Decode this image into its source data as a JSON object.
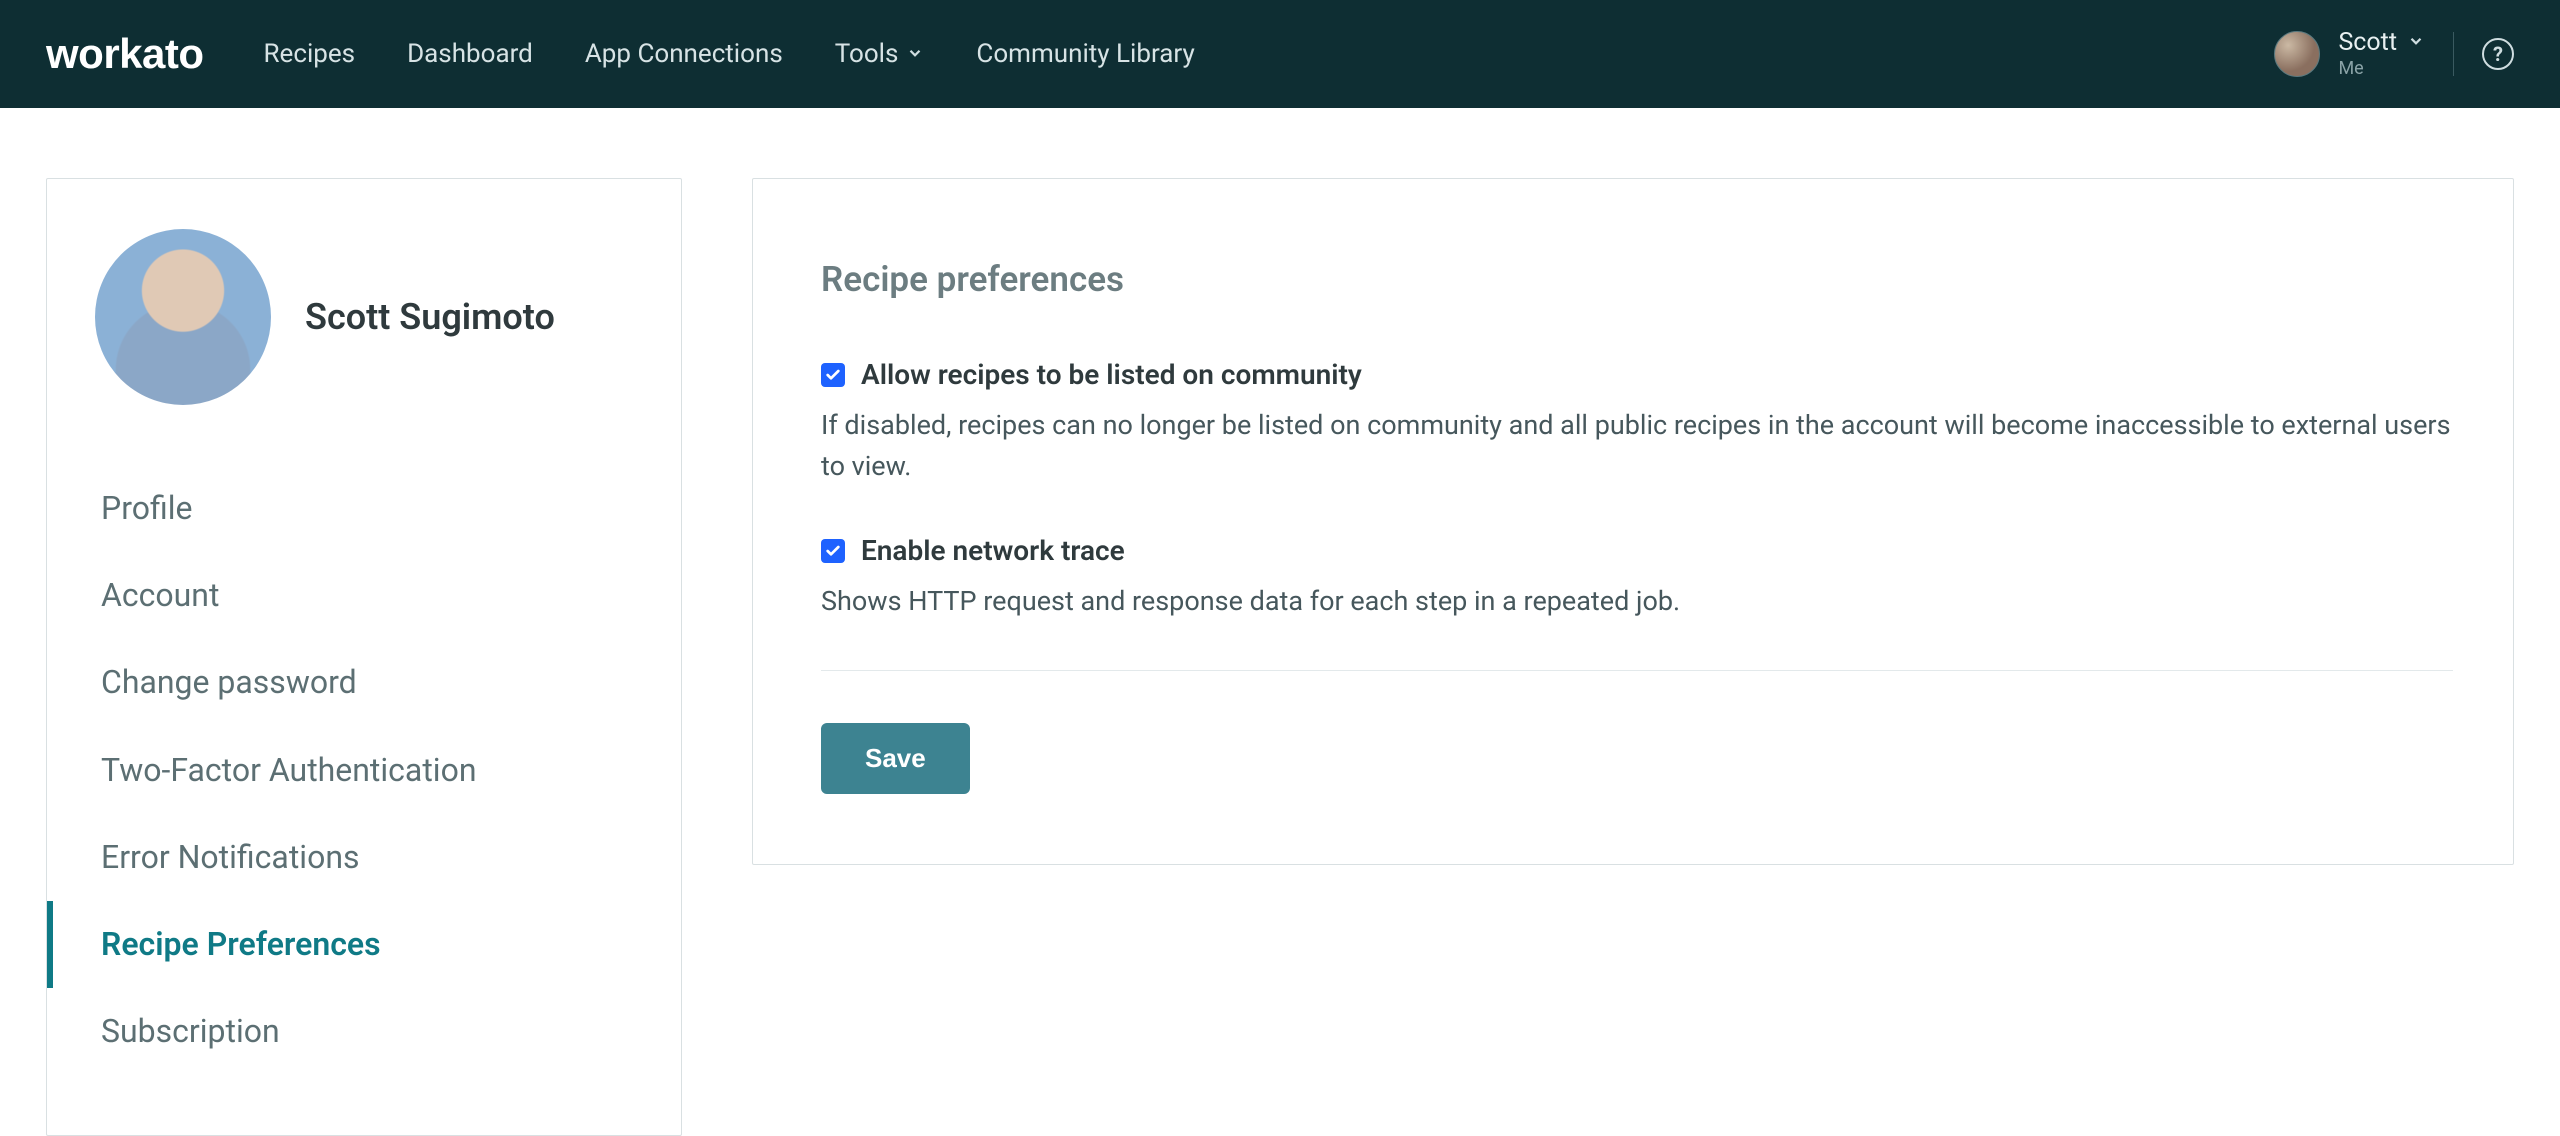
{
  "brand": "workato",
  "nav": {
    "recipes": "Recipes",
    "dashboard": "Dashboard",
    "app_connections": "App Connections",
    "tools": "Tools",
    "community": "Community Library"
  },
  "user": {
    "name": "Scott",
    "sub": "Me"
  },
  "sidebar": {
    "full_name": "Scott Sugimoto",
    "items": [
      {
        "label": "Profile",
        "active": false
      },
      {
        "label": "Account",
        "active": false
      },
      {
        "label": "Change password",
        "active": false
      },
      {
        "label": "Two-Factor Authentication",
        "active": false
      },
      {
        "label": "Error Notifications",
        "active": false
      },
      {
        "label": "Recipe Preferences",
        "active": true
      },
      {
        "label": "Subscription",
        "active": false
      }
    ]
  },
  "panel": {
    "title": "Recipe preferences",
    "allow_label": "Allow recipes to be listed on community",
    "allow_checked": true,
    "allow_desc": "If disabled, recipes can no longer be listed on community and all public recipes in the account will become inaccessible to external users to view.",
    "trace_label": "Enable network trace",
    "trace_checked": true,
    "trace_desc": "Shows HTTP request and response data for each step in a repeated job.",
    "save_label": "Save"
  }
}
